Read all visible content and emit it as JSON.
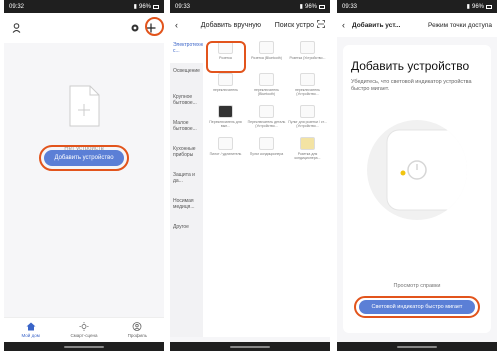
{
  "screens": [
    {
      "status": {
        "time": "09:32",
        "battery": "96%"
      },
      "empty_text": "Нет устройств",
      "add_device_button": "Добавить устройство",
      "tabs": [
        {
          "label": "Мой дом",
          "icon": "home-icon"
        },
        {
          "label": "Смарт-сцена",
          "icon": "sun-icon"
        },
        {
          "label": "Профиль",
          "icon": "profile-icon"
        }
      ]
    },
    {
      "status": {
        "time": "09:33",
        "battery": "96%"
      },
      "title_manual": "Добавить вручную",
      "title_search": "Поиск устро",
      "categories": [
        "Электротехнические с...",
        "Освещение",
        "Крупное бытовое...",
        "Малое бытовое...",
        "Кухонные приборы",
        "Защита и да...",
        "Носимая медиця...",
        "Другое"
      ],
      "devices": [
        "Розетка",
        "Розетка (Bluetooth)",
        "Розетка (Устройство...",
        "переключатель",
        "переключатель (Bluetooth)",
        "переключатель (Устройство...",
        "Переключатель для вып...",
        "Переключатель деталь (Устройство...",
        "Пульт для розетки / ст... (Устройство...",
        "Пилот / удлинитель",
        "Пульт кондиционера",
        "Розетка для кондиционера..."
      ]
    },
    {
      "status": {
        "time": "09:33",
        "battery": "96%"
      },
      "title_manual": "Добавить уст...",
      "title_ap": "Режим точки доступа",
      "card_title": "Добавить устройство",
      "card_desc": "Убедитесь, что световой индикатор устройства быстро мигает.",
      "help_link": "Просмотр справки",
      "confirm_button": "Световой индикатор быстро мигает"
    }
  ],
  "colors": {
    "accent": "#5b7fd6",
    "highlight_ring": "#e2541c",
    "active_tab": "#3a64c8"
  }
}
